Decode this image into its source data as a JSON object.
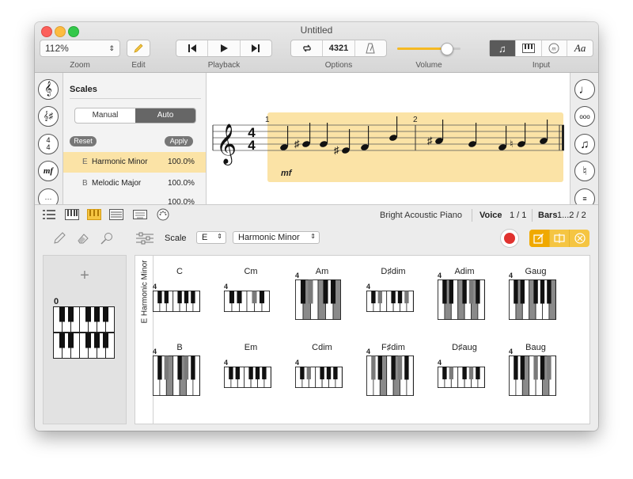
{
  "window": {
    "title": "Untitled"
  },
  "toolbar": {
    "zoom_value": "112%",
    "zoom_label": "Zoom",
    "edit_label": "Edit",
    "playback_label": "Playback",
    "options_label": "Options",
    "options_text": "4321",
    "volume_label": "Volume",
    "volume_level": 0.78,
    "input_label": "Input",
    "input_text": "Aa"
  },
  "scales_panel": {
    "title": "Scales",
    "mode_manual": "Manual",
    "mode_auto": "Auto",
    "reset_label": "Reset",
    "apply_label": "Apply",
    "items": [
      {
        "root": "E",
        "name": "Harmonic Minor",
        "pct": "100.0%"
      },
      {
        "root": "B",
        "name": "Melodic Major",
        "pct": "100.0%"
      },
      {
        "root": "",
        "name": "",
        "pct": "100.0%"
      }
    ]
  },
  "score": {
    "time_top": "4",
    "time_bottom": "4",
    "bar1": "1",
    "bar2": "2",
    "dynamic": "mf"
  },
  "left_strip": {
    "time_top": "4",
    "time_bottom": "4",
    "dynamic": "mf"
  },
  "status": {
    "instrument": "Bright Acoustic Piano",
    "voice_label": "Voice",
    "voice_value": "1 / 1",
    "bars_label": "Bars",
    "bars_value": "1...2 / 2"
  },
  "tools": {
    "scale_label": "Scale",
    "scale_root": "E",
    "scale_type": "Harmonic Minor"
  },
  "pad": {
    "add_symbol": "+",
    "number": "0"
  },
  "chord_panel": {
    "scale_caption": "E Harmonic Minor",
    "chords": [
      {
        "name": "C",
        "number": "4"
      },
      {
        "name": "Cm",
        "number": "4"
      },
      {
        "name": "Am",
        "number": "4"
      },
      {
        "name": "D♯dim",
        "number": "4"
      },
      {
        "name": "Adim",
        "number": "4"
      },
      {
        "name": "Gaug",
        "number": "4"
      },
      {
        "name": "B",
        "number": "4"
      },
      {
        "name": "Em",
        "number": "4"
      },
      {
        "name": "Cdim",
        "number": "4"
      },
      {
        "name": "F♯dim",
        "number": "4"
      },
      {
        "name": "D♯aug",
        "number": "4"
      },
      {
        "name": "Baug",
        "number": "4"
      }
    ]
  },
  "colors": {
    "accent_yellow": "#f5c542",
    "selection": "#fbe3a6",
    "record_red": "#e0322f",
    "pressed_key": "#7a7a7a"
  }
}
